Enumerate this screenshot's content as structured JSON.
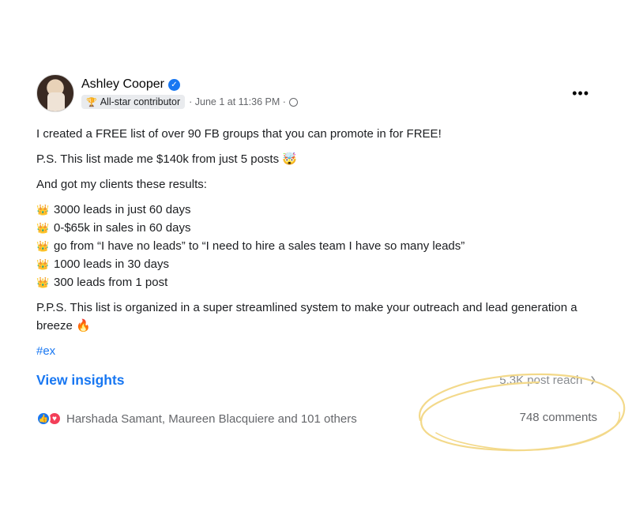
{
  "post": {
    "author": "Ashley Cooper",
    "verified_icon": "verified-check-icon",
    "badge": "All-star contributor",
    "badge_icon": "trophy-icon",
    "meta": "· June 1 at 11:36 PM ·",
    "privacy_icon": "globe-icon",
    "more_label": "•••",
    "paragraphs": {
      "p1": "I created a FREE list of over 90 FB groups that you can promote in for FREE!",
      "p2": "P.S. This list made me $140k from just 5 posts",
      "p2_emoji": "🤯",
      "p3": "And got my clients these results:",
      "list": [
        "3000 leads in just 60 days",
        "0-$65k in sales in 60 days",
        "go from “I have no leads” to “I need to hire a sales team I have so many leads”",
        "1000 leads in 30 days",
        "300 leads from 1 post"
      ],
      "list_emoji": "👑",
      "p4": "P.P.S. This list is organized in a super streamlined system to make your outreach and lead generation a breeze",
      "p4_emoji": "🔥",
      "hashtag": "#ex"
    },
    "insights": {
      "view_insights": "View insights",
      "reach": "5.3K post reach",
      "chevron": "›"
    },
    "engagement": {
      "reactors": "Harshada Samant, Maureen Blacquiere and 101 others",
      "comments": "748 comments",
      "reaction_icons": [
        "like-icon",
        "love-icon"
      ]
    },
    "annotation_color": "#f3d98a"
  }
}
